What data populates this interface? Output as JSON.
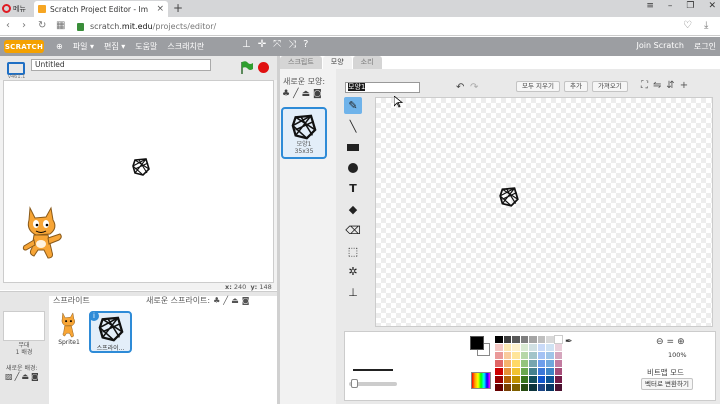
{
  "browser": {
    "menu_label": "메뉴",
    "tab_title": "Scratch Project Editor - Im",
    "url_prefix": "scratch.",
    "url_host": "mit.edu",
    "url_path": "/projects/editor/"
  },
  "menubar": {
    "logo": "SCRATCH",
    "items": [
      "파일",
      "편집",
      "도움말",
      "스크래치란"
    ],
    "join": "Join Scratch",
    "login": "로그인"
  },
  "stage": {
    "project_title": "Untitled",
    "version": "v461.1",
    "x_label": "x:",
    "x_value": "240",
    "y_label": "y:",
    "y_value": "148"
  },
  "sprites": {
    "header": "스프라이트",
    "new_sprite": "새로운 스프라이트:",
    "stage_label": "무대",
    "backdrop_count": "1 배경",
    "new_backdrop": "새로운 배경:",
    "list": [
      {
        "name": "Sprite1"
      },
      {
        "name": "스프라이..."
      }
    ]
  },
  "editor": {
    "tabs": [
      "스크립트",
      "모양",
      "소리"
    ],
    "new_costume": "새로운 모양:",
    "costume": {
      "name": "모양1",
      "size": "35x35"
    },
    "name_field": "모양1",
    "buttons": [
      "모두 지우기",
      "추가",
      "가져오기"
    ],
    "zoom_level": "100%",
    "mode_label": "비트맵 모드",
    "convert_label": "벡터로 변환하기"
  },
  "colors": {
    "accent_blue": "#2e8bd7",
    "menubar_gray": "#9c9ea2",
    "logo_orange": "#f4a100",
    "stop_red": "#e01010",
    "flag_green": "#2e9e2e"
  },
  "palette_colors": [
    "#000000",
    "#3f3f3f",
    "#595959",
    "#7f7f7f",
    "#a5a5a5",
    "#bfbfbf",
    "#d8d8d8",
    "#ffffff",
    "#f4c7c3",
    "#fce8b2",
    "#fff2cc",
    "#d9ead3",
    "#d0e0e3",
    "#c9daf8",
    "#cfe2f3",
    "#ead1dc",
    "#ea9999",
    "#f9cb9c",
    "#ffe599",
    "#b6d7a8",
    "#a2c4c9",
    "#a4c2f4",
    "#9fc5e8",
    "#d5a6bd",
    "#e06666",
    "#f6b26b",
    "#ffd966",
    "#93c47d",
    "#76a5af",
    "#6d9eeb",
    "#6fa8dc",
    "#c27ba0",
    "#cc0000",
    "#e69138",
    "#f1c232",
    "#6aa84f",
    "#45818e",
    "#3c78d8",
    "#3d85c6",
    "#a64d79",
    "#990000",
    "#b45f06",
    "#bf9000",
    "#38761d",
    "#134f5c",
    "#1155cc",
    "#0b5394",
    "#741b47",
    "#660000",
    "#783f04",
    "#7f6000",
    "#274e13",
    "#0c343d",
    "#1c4587",
    "#073763",
    "#4c1130"
  ]
}
